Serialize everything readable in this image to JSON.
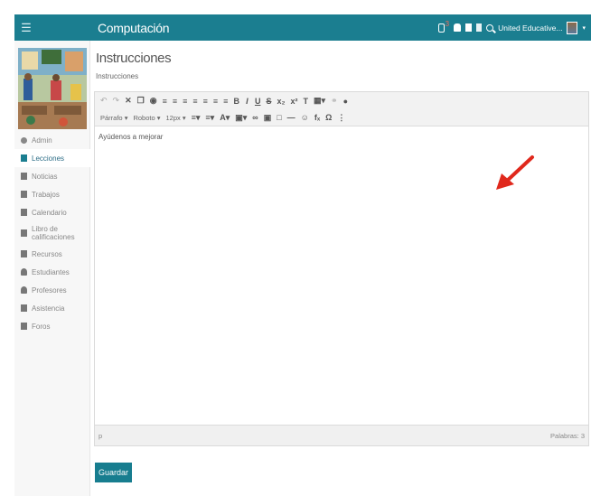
{
  "header": {
    "title": "Computación",
    "notif_badge": "3",
    "user_name": "United Educative..."
  },
  "sidebar": {
    "items": [
      {
        "label": "Admin",
        "icon": "gear-icon"
      },
      {
        "label": "Lecciones",
        "icon": "book-icon",
        "active": true
      },
      {
        "label": "Noticias",
        "icon": "pin-icon"
      },
      {
        "label": "Trabajos",
        "icon": "file-icon"
      },
      {
        "label": "Calendario",
        "icon": "calendar-icon"
      },
      {
        "label": "Libro de calificaciones",
        "icon": "gradebook-icon"
      },
      {
        "label": "Recursos",
        "icon": "resources-icon"
      },
      {
        "label": "Estudiantes",
        "icon": "student-icon"
      },
      {
        "label": "Profesores",
        "icon": "teacher-icon"
      },
      {
        "label": "Asistencia",
        "icon": "attendance-icon"
      },
      {
        "label": "Foros",
        "icon": "forum-icon"
      }
    ]
  },
  "main": {
    "title": "Instrucciones",
    "field_label": "Instrucciones",
    "editor": {
      "format_select": "Párrafo",
      "font_select": "Roboto",
      "size_select": "12px",
      "content": "Ayúdenos a mejorar",
      "status_path": "p",
      "word_count": "Palabras: 3"
    },
    "save_label": "Guardar"
  },
  "colors": {
    "topbar": "#1b7e90",
    "accent_button": "#177d8f",
    "annotation_arrow": "#e0281c"
  }
}
